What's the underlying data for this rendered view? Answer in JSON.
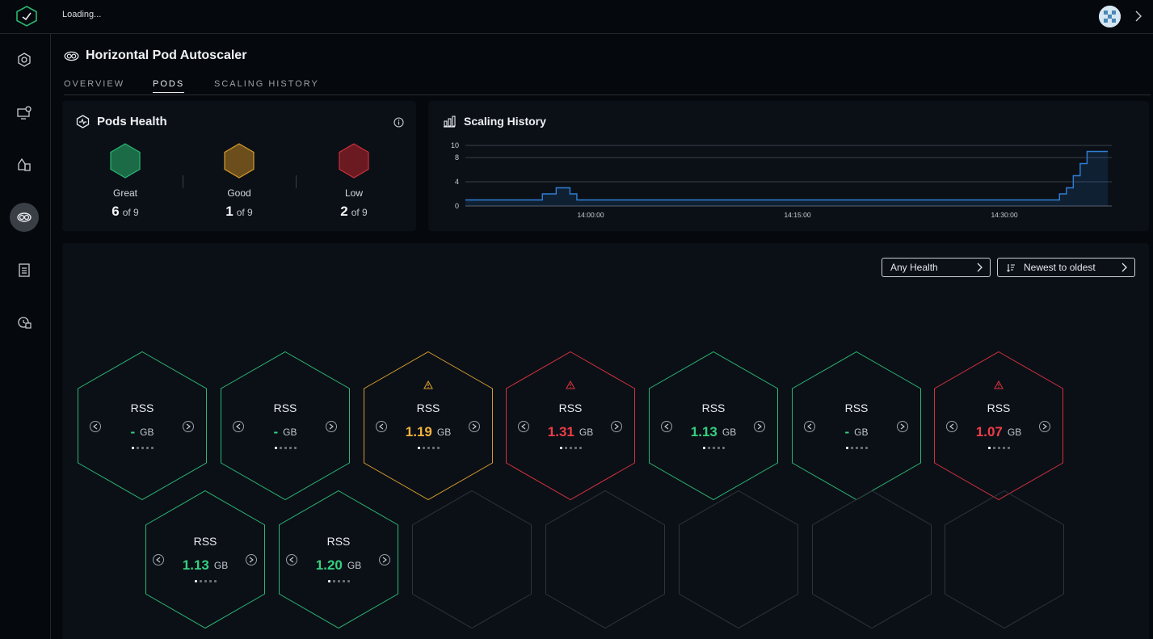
{
  "topbar": {
    "loading_text": "Loading..."
  },
  "page": {
    "title": "Horizontal Pod Autoscaler",
    "tabs": [
      {
        "label": "OVERVIEW",
        "active": false
      },
      {
        "label": "PODS",
        "active": true
      },
      {
        "label": "SCALING HISTORY",
        "active": false
      }
    ]
  },
  "pods_health": {
    "title": "Pods Health",
    "items": [
      {
        "label": "Great",
        "count": "6",
        "of": "of 9",
        "color": "#1a6b46",
        "border": "#2bb673"
      },
      {
        "label": "Good",
        "count": "1",
        "of": "of 9",
        "color": "#6b4e1c",
        "border": "#d49a2a"
      },
      {
        "label": "Low",
        "count": "2",
        "of": "of 9",
        "color": "#6a1a20",
        "border": "#c9303b"
      }
    ]
  },
  "scaling_history": {
    "title": "Scaling History"
  },
  "chart_data": {
    "type": "area",
    "title": "Scaling History",
    "xlabel": "",
    "ylabel": "",
    "yticks": [
      0,
      4,
      8,
      10
    ],
    "ylim": [
      0,
      10
    ],
    "xticks": [
      "14:00:00",
      "14:15:00",
      "14:30:00"
    ],
    "series": [
      {
        "x_minutes": [
          -8,
          -4.5,
          -3.5,
          -2.5,
          -1.5,
          -1,
          33.5,
          34,
          34.5,
          35,
          35.5,
          36,
          37.5
        ],
        "values": [
          1,
          1,
          2,
          3,
          2,
          1,
          1,
          2,
          3,
          5,
          7,
          9,
          9
        ]
      }
    ],
    "color": "#2f7fd6",
    "grid": true
  },
  "filters": {
    "health": "Any Health",
    "sort": "Newest to oldest"
  },
  "pods": [
    {
      "label": "RSS",
      "value": "-",
      "unit": "GB",
      "status": "great",
      "warning": false
    },
    {
      "label": "RSS",
      "value": "-",
      "unit": "GB",
      "status": "great",
      "warning": false
    },
    {
      "label": "RSS",
      "value": "1.19",
      "unit": "GB",
      "status": "good",
      "warning": true
    },
    {
      "label": "RSS",
      "value": "1.31",
      "unit": "GB",
      "status": "low",
      "warning": true
    },
    {
      "label": "RSS",
      "value": "1.13",
      "unit": "GB",
      "status": "great",
      "warning": false
    },
    {
      "label": "RSS",
      "value": "-",
      "unit": "GB",
      "status": "great",
      "warning": false
    },
    {
      "label": "RSS",
      "value": "1.07",
      "unit": "GB",
      "status": "low",
      "warning": true
    },
    {
      "label": "RSS",
      "value": "1.13",
      "unit": "GB",
      "status": "great",
      "warning": false
    },
    {
      "label": "RSS",
      "value": "1.20",
      "unit": "GB",
      "status": "great",
      "warning": false
    }
  ],
  "status_colors": {
    "great": "#2bb673",
    "good": "#d49a2a",
    "low": "#d2313c",
    "empty": "#2f343b",
    "value_great": "#35d07f",
    "value_good": "#f0b23b",
    "value_low": "#ef3d47"
  }
}
